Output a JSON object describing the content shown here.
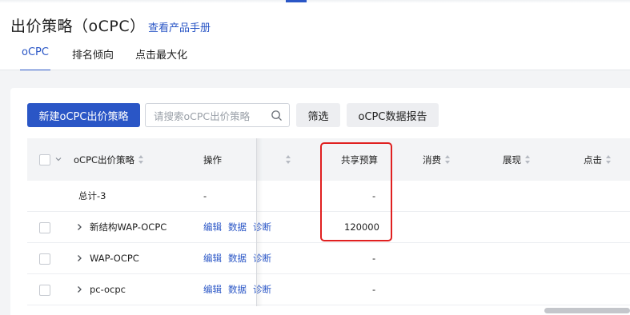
{
  "page": {
    "title": "出价策略（oCPC）",
    "manual_link": "查看产品手册"
  },
  "tabs": [
    {
      "label": "oCPC",
      "active": true
    },
    {
      "label": "排名倾向",
      "active": false
    },
    {
      "label": "点击最大化",
      "active": false
    }
  ],
  "toolbar": {
    "new_button": "新建oCPC出价策略",
    "search_placeholder": "请搜索oCPC出价策略",
    "search_value": "",
    "filter_button": "筛选",
    "report_button": "oCPC数据报告"
  },
  "table": {
    "columns": {
      "name": "oCPC出价策略",
      "operation": "操作",
      "budget": "共享预算",
      "cost": "消费",
      "impressions": "展现",
      "clicks": "点击"
    },
    "rows": [
      {
        "name": "总计-3",
        "operation": "-",
        "budget": "-",
        "expandable": false,
        "checkbox": false
      },
      {
        "name": "新结构WAP-OCPC",
        "ops": [
          "编辑",
          "数据",
          "诊断"
        ],
        "budget": "120000",
        "expandable": true,
        "checkbox": true
      },
      {
        "name": "WAP-OCPC",
        "ops": [
          "编辑",
          "数据",
          "诊断"
        ],
        "budget": "-",
        "expandable": true,
        "checkbox": true
      },
      {
        "name": "pc-ocpc",
        "ops": [
          "编辑",
          "数据",
          "诊断"
        ],
        "budget": "-",
        "expandable": true,
        "checkbox": true
      }
    ]
  },
  "colors": {
    "accent": "#2a56c6",
    "highlight": "#e02020",
    "header_bg": "#f3f4f6"
  },
  "icons": {
    "search": "search-icon",
    "expand": "chevron-right-icon",
    "sort": "sort-icon",
    "select_all_dropdown": "chevron-down-icon"
  }
}
